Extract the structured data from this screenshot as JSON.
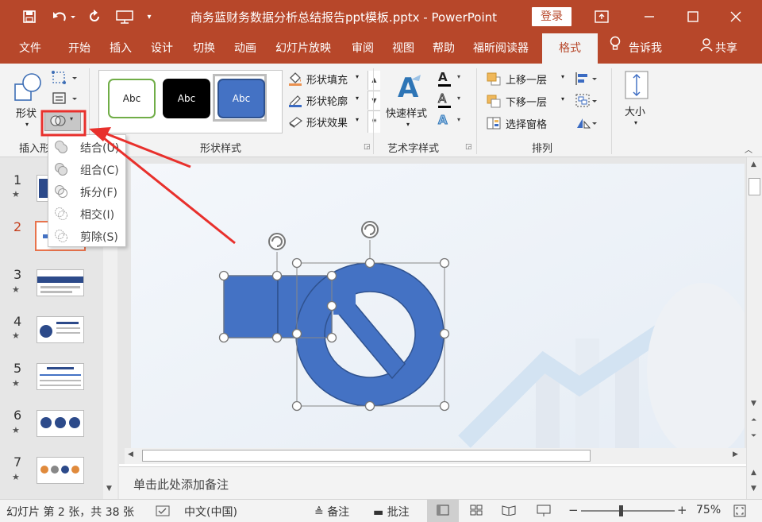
{
  "titlebar": {
    "document_title": "商务蓝财务数据分析总结报告ppt模板.pptx  -  PowerPoint",
    "login_label": "登录"
  },
  "tabs": [
    {
      "label": "文件"
    },
    {
      "label": "开始"
    },
    {
      "label": "插入"
    },
    {
      "label": "设计"
    },
    {
      "label": "切换"
    },
    {
      "label": "动画"
    },
    {
      "label": "幻灯片放映"
    },
    {
      "label": "审阅"
    },
    {
      "label": "视图"
    },
    {
      "label": "帮助"
    },
    {
      "label": "福昕阅读器"
    },
    {
      "label": "格式"
    }
  ],
  "tell_me": "告诉我",
  "share": "共享",
  "ribbon": {
    "insert_shapes": {
      "shape_label": "形状",
      "group_label": "插入形"
    },
    "shape_styles": {
      "presets": [
        "Abc",
        "Abc",
        "Abc"
      ],
      "fill": "形状填充",
      "outline": "形状轮廓",
      "effect": "形状效果",
      "group_label": "形状样式"
    },
    "wordart": {
      "quick_styles": "快速样式",
      "text_char": "A",
      "group_label": "艺术字样式"
    },
    "arrange": {
      "bring_forward": "上移一层",
      "send_backward": "下移一层",
      "selection_pane": "选择窗格",
      "group_label": "排列"
    },
    "size": {
      "label": "大小"
    }
  },
  "merge_menu": [
    {
      "label": "结合(U)"
    },
    {
      "label": "组合(C)"
    },
    {
      "label": "拆分(F)"
    },
    {
      "label": "相交(I)"
    },
    {
      "label": "剪除(S)"
    }
  ],
  "slides": [
    {
      "num": "1"
    },
    {
      "num": "2"
    },
    {
      "num": "3"
    },
    {
      "num": "4"
    },
    {
      "num": "5"
    },
    {
      "num": "6"
    },
    {
      "num": "7"
    }
  ],
  "star": "★",
  "notes_placeholder": "单击此处添加备注",
  "statusbar": {
    "slide_info": "幻灯片 第 2 张，共 38 张",
    "language": "中文(中国)",
    "notes": "备注",
    "comments": "批注",
    "zoom": "75%"
  },
  "colors": {
    "brand": "#b7472a",
    "shape_fill": "#4472c4",
    "shape_outline": "#2f528f",
    "highlight": "#e8302c"
  }
}
